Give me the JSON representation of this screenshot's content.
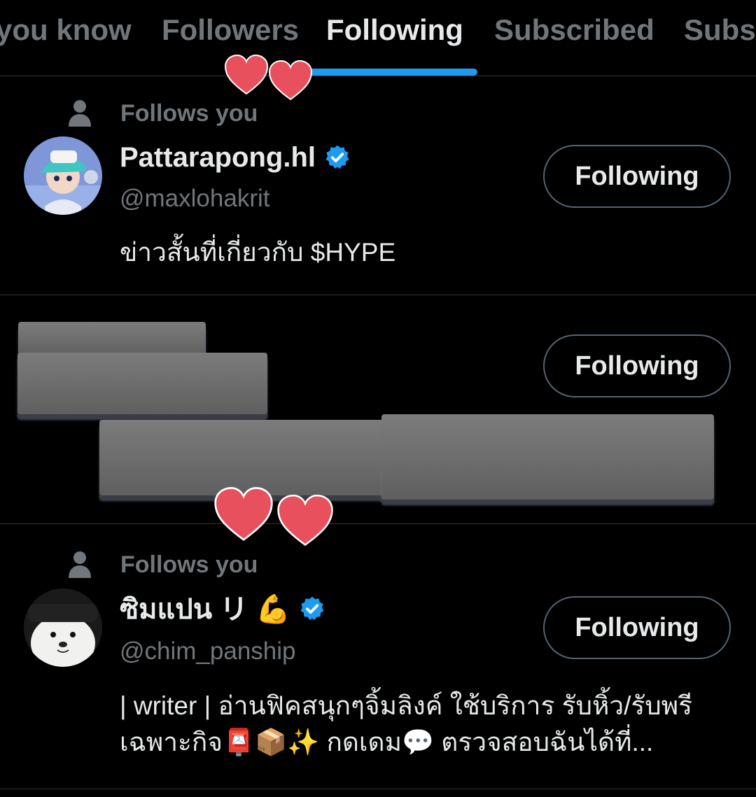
{
  "tabs": [
    {
      "label": "you know",
      "active": false
    },
    {
      "label": "Followers",
      "active": false
    },
    {
      "label": "Following",
      "active": true
    },
    {
      "label": "Subscribed",
      "active": false
    },
    {
      "label": "Subsc",
      "active": false
    }
  ],
  "colors": {
    "background": "#000000",
    "accent": "#1d9bf0",
    "muted_text": "#71767b",
    "primary_text": "#e7e9ea",
    "divider": "#2f3336",
    "heart": "#e8505e"
  },
  "users": [
    {
      "social_context": "Follows you",
      "name": "Pattarapong.hl",
      "verified": true,
      "handle": "@maxlohakrit",
      "bio": "ข่าวสั้นที่เกี่ยวกับ $HYPE",
      "button_label": "Following"
    },
    {
      "redacted": true,
      "button_label": "Following"
    },
    {
      "social_context": "Follows you",
      "name": "ซิมแปน リ 💪",
      "verified": true,
      "handle": "@chim_panship",
      "bio": "| writer | อ่านฟิคสนุกๆจิ้มลิงค์ ใช้บริการ รับหิ้ว/รับพรีเฉพาะกิจ📮📦✨ กดเดม💬 ตรวจสอบฉันได้ที่...",
      "button_label": "Following"
    }
  ]
}
